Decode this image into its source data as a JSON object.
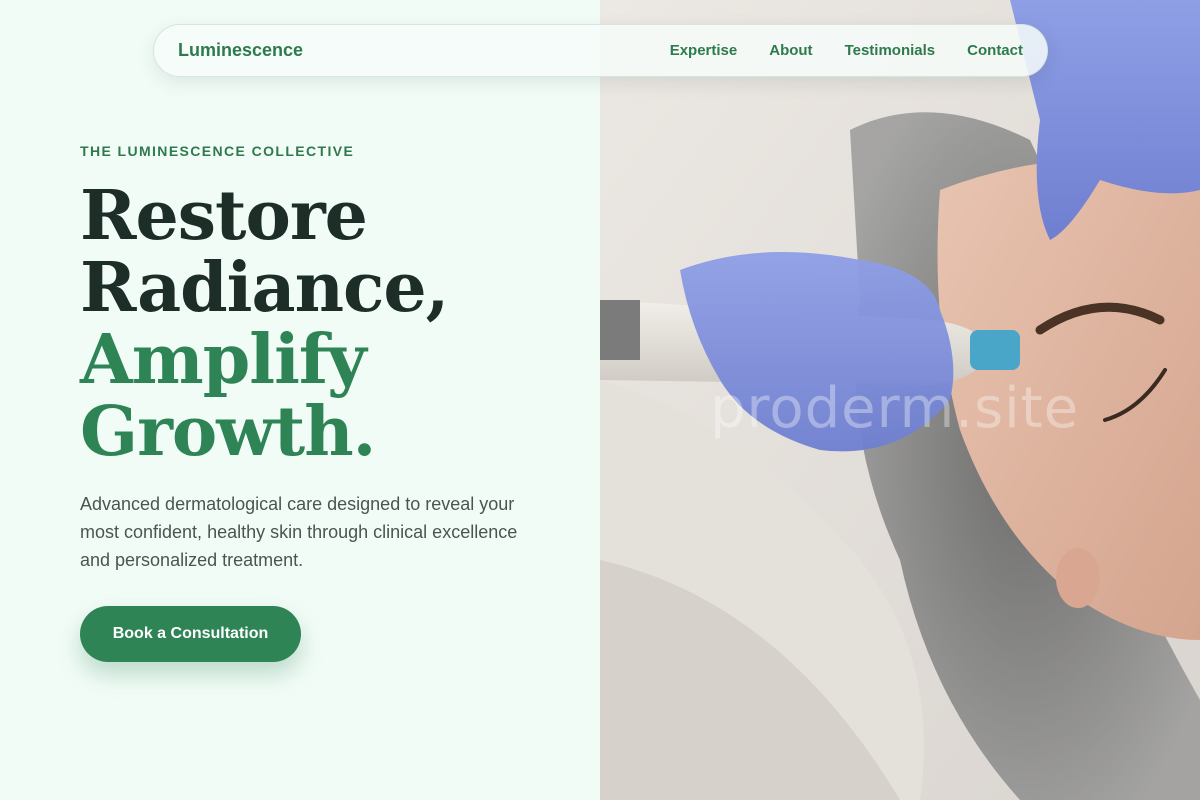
{
  "nav": {
    "brand": "Luminescence",
    "links": [
      "Expertise",
      "About",
      "Testimonials",
      "Contact"
    ]
  },
  "hero": {
    "eyebrow": "THE LUMINESCENCE COLLECTIVE",
    "headline_line1": "Restore",
    "headline_line2": "Radiance,",
    "headline_line3": "Amplify",
    "headline_line4": "Growth.",
    "description": "Advanced dermatological care designed to reveal your most confident, healthy skin through clinical excellence and personalized treatment.",
    "cta_label": "Book a Consultation",
    "image_watermark": "proderm.site"
  },
  "colors": {
    "background": "#f2fcf7",
    "brand_green": "#2e7a4d",
    "accent_green": "#2e8455",
    "heading_dark": "#1c2e27",
    "body_text": "#4a5552"
  }
}
